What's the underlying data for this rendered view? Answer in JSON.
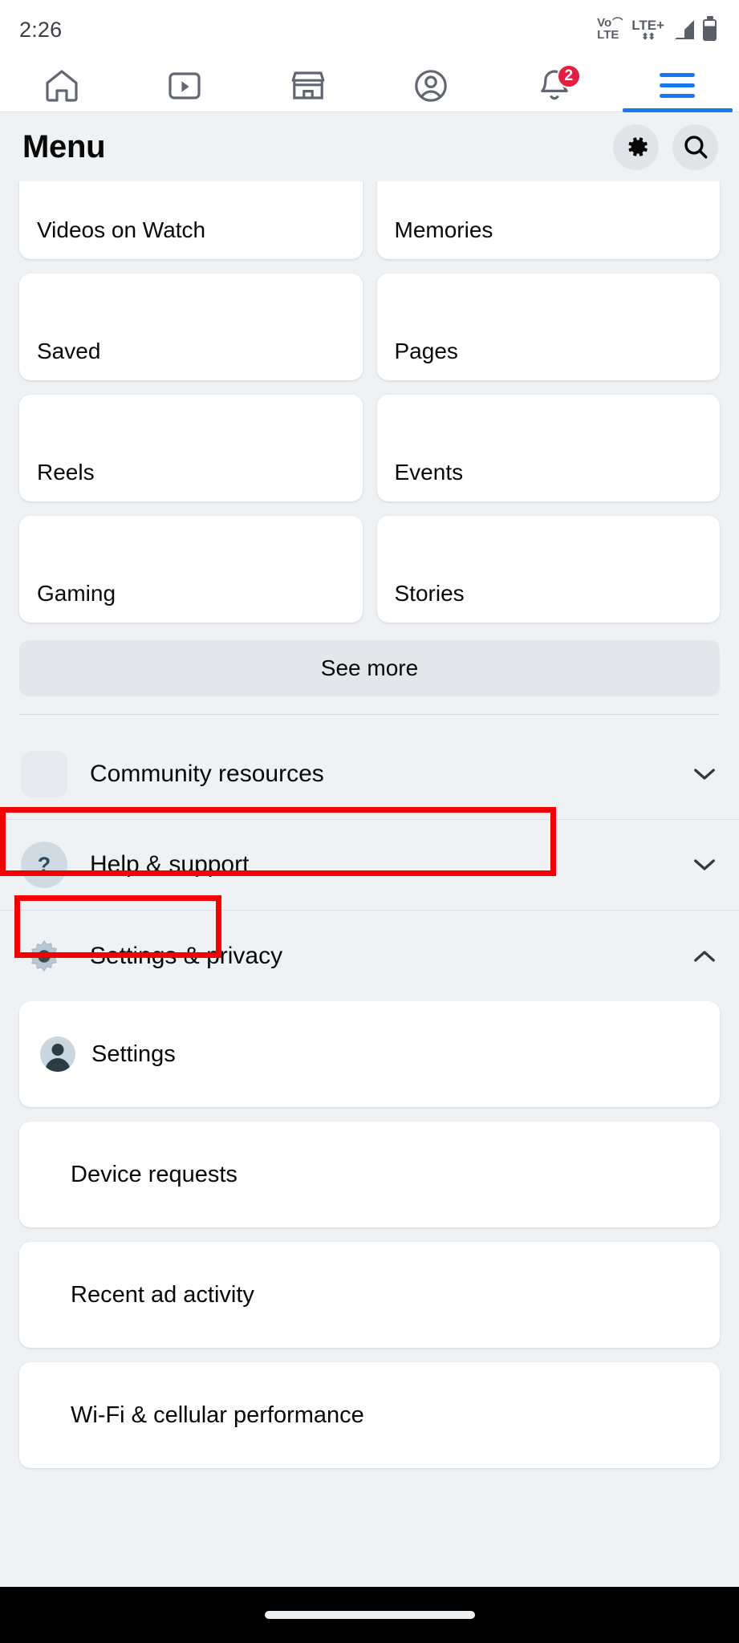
{
  "status_bar": {
    "time": "2:26",
    "volte_top": "Vo",
    "volte_bottom": "LTE",
    "network": "LTE+",
    "network_arrows": "⬍",
    "signal_icon": "signal-bars-icon",
    "battery_icon": "battery-icon"
  },
  "top_tabs": [
    {
      "name": "home",
      "icon": "home-icon",
      "badge": null,
      "active": false
    },
    {
      "name": "video",
      "icon": "video-play-icon",
      "badge": null,
      "active": false
    },
    {
      "name": "marketplace",
      "icon": "marketplace-store-icon",
      "badge": null,
      "active": false
    },
    {
      "name": "profile",
      "icon": "profile-circle-icon",
      "badge": null,
      "active": false
    },
    {
      "name": "notifications",
      "icon": "bell-icon",
      "badge": "2",
      "active": false
    },
    {
      "name": "menu",
      "icon": "hamburger-menu-icon",
      "badge": null,
      "active": true
    }
  ],
  "header": {
    "title": "Menu",
    "settings_icon": "gear-icon",
    "search_icon": "search-icon"
  },
  "shortcut_tiles": [
    {
      "label": "Videos on Watch",
      "clipped": true
    },
    {
      "label": "Memories",
      "clipped": true
    },
    {
      "label": "Saved",
      "clipped": false
    },
    {
      "label": "Pages",
      "clipped": false
    },
    {
      "label": "Reels",
      "clipped": false
    },
    {
      "label": "Events",
      "clipped": false
    },
    {
      "label": "Gaming",
      "clipped": false
    },
    {
      "label": "Stories",
      "clipped": false
    }
  ],
  "see_more_label": "See more",
  "accordions": [
    {
      "label": "Community resources",
      "icon": "placeholder-square-icon",
      "expanded": false,
      "chevron": "chevron-down-icon",
      "highlighted": false
    },
    {
      "label": "Help & support",
      "icon": "question-mark-circle-icon",
      "expanded": false,
      "chevron": "chevron-down-icon",
      "highlighted": false
    },
    {
      "label": "Settings & privacy",
      "icon": "gear-icon",
      "expanded": true,
      "chevron": "chevron-up-icon",
      "highlighted": true
    }
  ],
  "settings_submenu": [
    {
      "label": "Settings",
      "icon": "person-avatar-icon",
      "highlighted": true
    },
    {
      "label": "Device requests",
      "icon": null,
      "highlighted": false
    },
    {
      "label": "Recent ad activity",
      "icon": null,
      "highlighted": false
    },
    {
      "label": "Wi-Fi & cellular performance",
      "icon": null,
      "highlighted": false
    }
  ],
  "colors": {
    "page_background": "#eff2f5",
    "card_background": "#ffffff",
    "accent_blue": "#1877f2",
    "badge_red": "#e41e3f",
    "annotation_red": "#f50000",
    "text_primary": "#080809",
    "nav_bar": "#000000"
  },
  "nav_bar": {
    "gesture_pill": "gesture-home-pill"
  }
}
